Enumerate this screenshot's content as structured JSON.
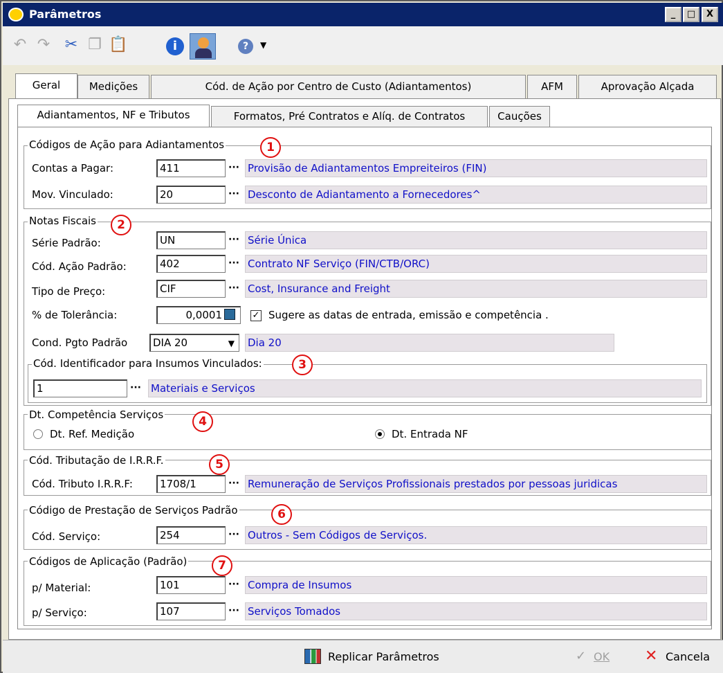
{
  "window": {
    "title": "Parâmetros",
    "btn_min": "_",
    "btn_max": "□",
    "btn_close": "X"
  },
  "main_tabs": [
    "Geral",
    "Medições",
    "Cód. de Ação por Centro de Custo (Adiantamentos)",
    "AFM",
    "Aprovação Alçada"
  ],
  "sub_tabs": [
    "Adiantamentos, NF e Tributos",
    "Formatos, Pré Contratos e Alíq. de Contratos",
    "Cauções"
  ],
  "dots": "···",
  "g1": {
    "title": "Códigos de Ação para Adiantamentos",
    "num": "1",
    "contas_label": "Contas a Pagar:",
    "contas_val": "411",
    "contas_desc": "Provisão de Adiantamentos Empreiteiros (FIN)",
    "mov_label": "Mov. Vinculado:",
    "mov_val": "20",
    "mov_desc": "Desconto de Adiantamento a Fornecedores^"
  },
  "g2": {
    "title": "Notas Fiscais",
    "num": "2",
    "serie_label": "Série Padrão:",
    "serie_val": "UN",
    "serie_desc": "Série Única",
    "acao_label": "Cód. Ação Padrão:",
    "acao_val": "402",
    "acao_desc": "Contrato NF Serviço (FIN/CTB/ORC)",
    "preco_label": "Tipo de Preço:",
    "preco_val": "CIF",
    "preco_desc": "Cost, Insurance and Freight",
    "tol_label": "% de Tolerância:",
    "tol_val": "0,0001",
    "chk_label": "Sugere as datas de entrada, emissão e competência .",
    "chk_on": true,
    "cond_label": "Cond. Pgto Padrão",
    "cond_val": "DIA 20",
    "cond_desc": "Dia 20"
  },
  "g3": {
    "title": "Cód. Identificador para Insumos Vinculados:",
    "num": "3",
    "val": "1",
    "desc": "Materiais e Serviços"
  },
  "g4": {
    "title": "Dt. Competência Serviços",
    "num": "4",
    "opt1": "Dt. Ref. Medição",
    "opt2": "Dt. Entrada NF",
    "selected": "Dt. Entrada NF"
  },
  "g5": {
    "title": "Cód. Tributação de I.R.R.F.",
    "num": "5",
    "label": "Cód. Tributo I.R.R.F:",
    "val": "1708/1",
    "desc": "Remuneração de Serviços Profissionais prestados por pessoas juridicas"
  },
  "g6": {
    "title": "Código de Prestação de Serviços Padrão",
    "num": "6",
    "label": "Cód. Serviço:",
    "val": "254",
    "desc": "Outros - Sem Códigos de Serviços."
  },
  "g7": {
    "title": "Códigos de Aplicação (Padrão)",
    "num": "7",
    "mat_label": "p/ Material:",
    "mat_val": "101",
    "mat_desc": "Compra de Insumos",
    "serv_label": "p/ Serviço:",
    "serv_val": "107",
    "serv_desc": "Serviços Tomados"
  },
  "footer": {
    "replicar": "Replicar Parâmetros",
    "ok": "OK",
    "cancela": "Cancela"
  }
}
